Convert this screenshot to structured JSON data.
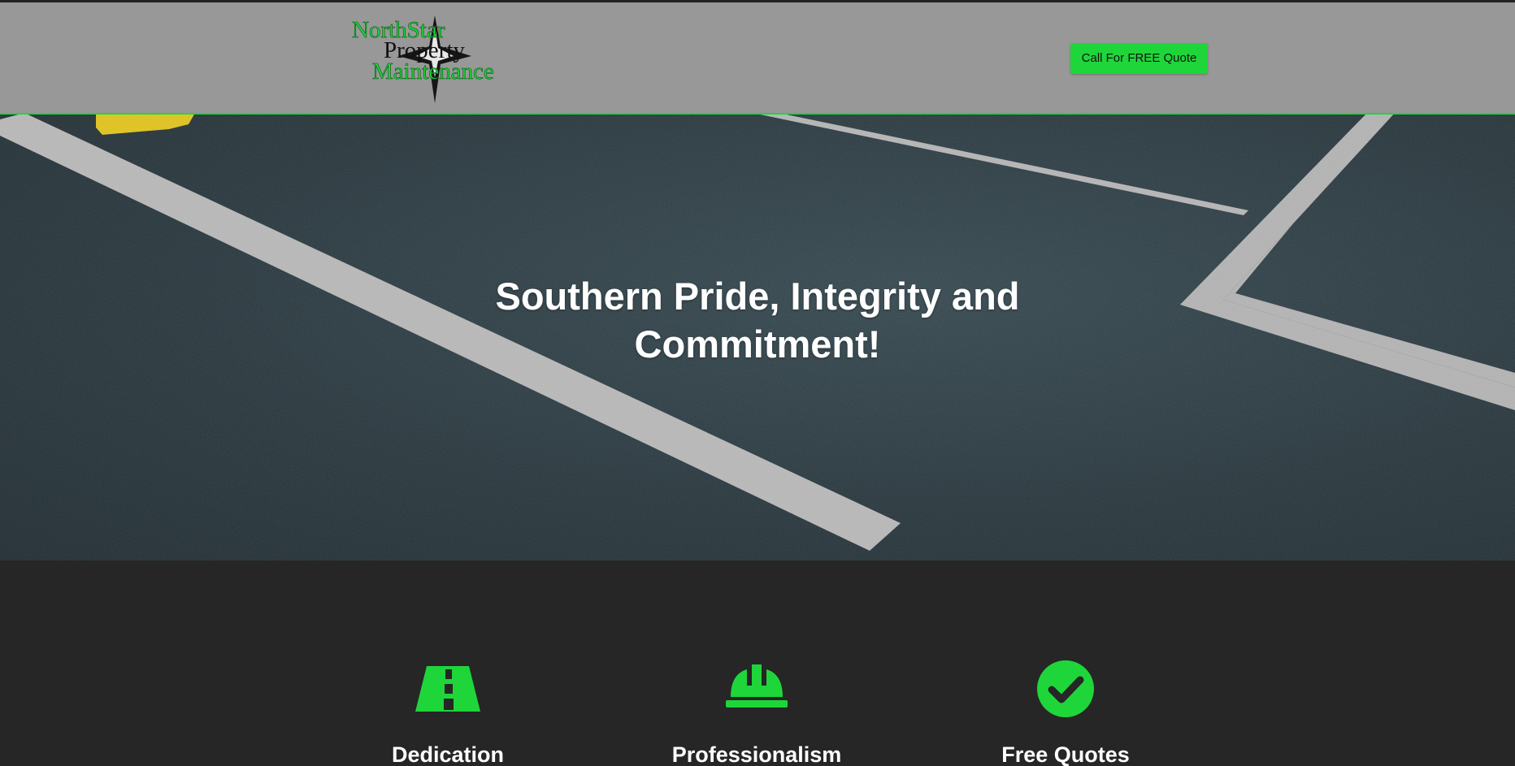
{
  "header": {
    "logo": {
      "line1": "NorthStar",
      "line2": "Property",
      "line3": "Maintenance"
    },
    "cta_label": "Call For FREE Quote"
  },
  "hero": {
    "title": "Southern Pride, Integrity and Commitment!"
  },
  "features": [
    {
      "title": "Dedication",
      "icon": "road-icon"
    },
    {
      "title": "Professionalism",
      "icon": "hard-hat-icon"
    },
    {
      "title": "Free Quotes",
      "icon": "check-circle-icon"
    }
  ],
  "colors": {
    "accent": "#1ed63a",
    "header_bg": "#989898",
    "dark_bg": "#262626",
    "asphalt": "#2b3c43",
    "stripe": "#b9b9b9"
  }
}
